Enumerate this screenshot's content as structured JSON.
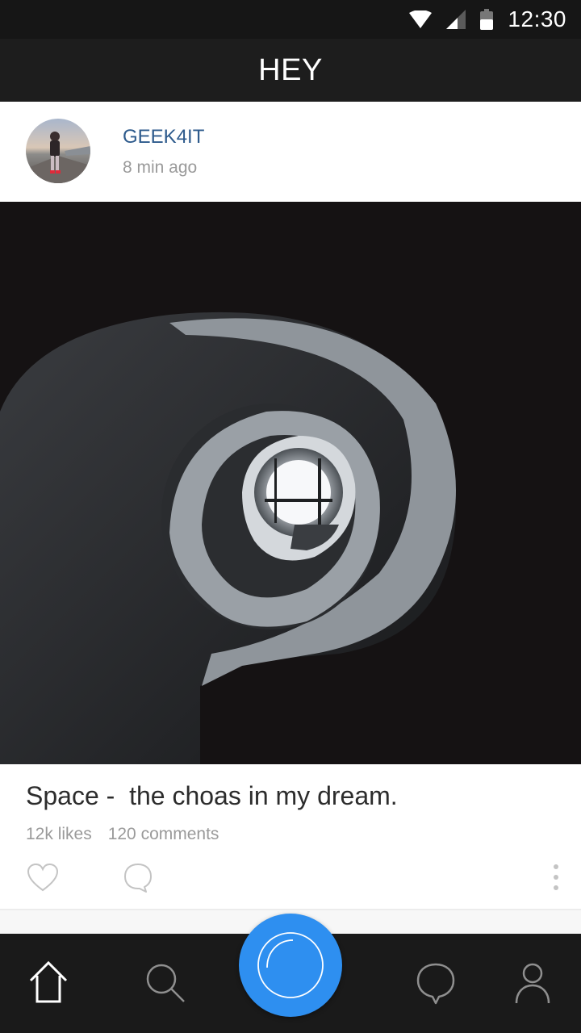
{
  "status_bar": {
    "time": "12:30",
    "icons": [
      "wifi-icon",
      "cell-signal-icon",
      "battery-icon"
    ]
  },
  "app_bar": {
    "title": "HEY"
  },
  "post": {
    "author": "GEEK4IT",
    "time_ago": "8 min ago",
    "caption": "Space -  the choas in my dream.",
    "likes": "12k likes",
    "comments": "120 comments",
    "actions": [
      "heart-icon",
      "comment-icon",
      "more-vert-icon"
    ]
  },
  "bottom_nav": {
    "items": [
      "home-icon",
      "search-icon",
      "camera-icon",
      "chat-icon",
      "profile-icon"
    ]
  },
  "colors": {
    "accent": "#2e8ff0",
    "username": "#2d5a8c",
    "dark_bar": "#1d1d1d",
    "muted_text": "#9a9a9a"
  }
}
